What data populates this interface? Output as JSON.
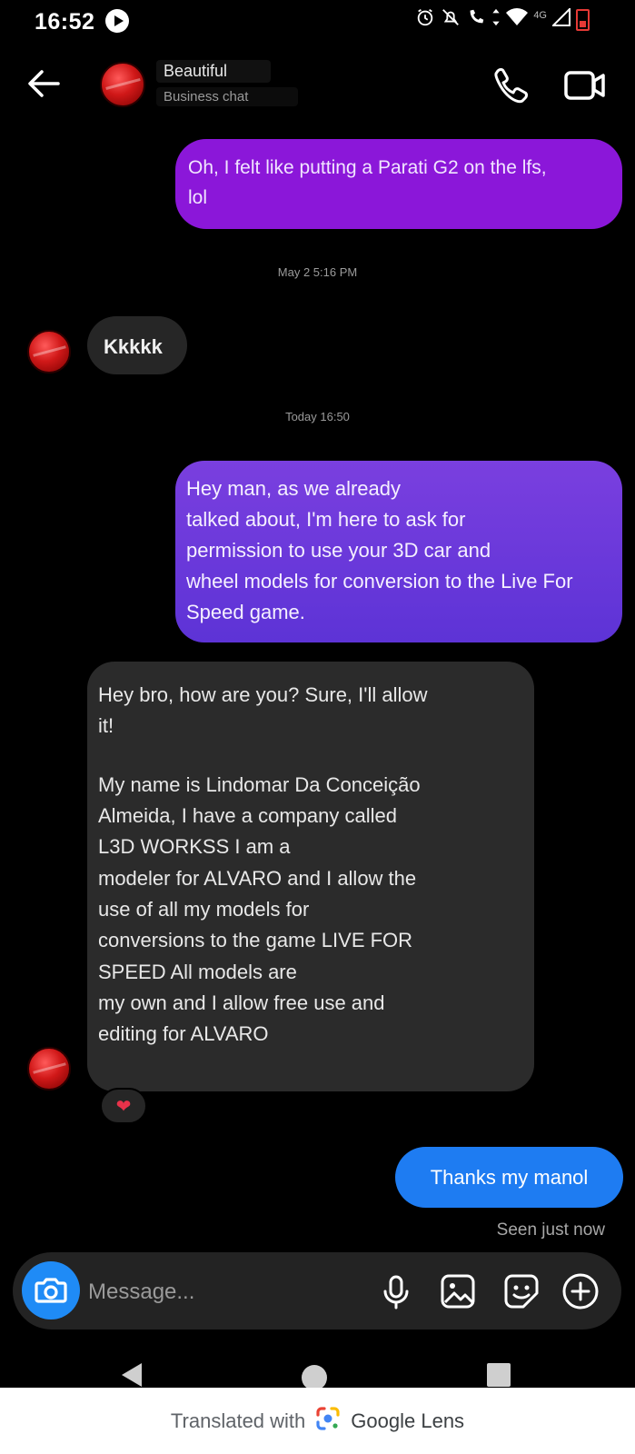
{
  "status_bar": {
    "time": "16:52",
    "network_label": "4G",
    "icons": [
      "play-icon",
      "alarm-icon",
      "mute-icon",
      "wifi-calling-icon",
      "data-arrows-icon",
      "wifi-icon",
      "signal-icon",
      "battery-low-icon"
    ]
  },
  "header": {
    "contact_name": "Beautiful",
    "subtitle": "Business chat"
  },
  "messages": {
    "m1": {
      "sender": "me",
      "lines": [
        "Oh, I felt like putting a Parati G2 on the lfs,",
        "lol"
      ]
    },
    "ts1": "May 2 5:16 PM",
    "m2": {
      "sender": "contact",
      "text": "Kkkkk"
    },
    "ts2": "Today 16:50",
    "m3": {
      "sender": "me",
      "lines": [
        "Hey man, as we already",
        "talked about, I'm here to ask for",
        "permission to use your 3D car and",
        "wheel models for conversion to the Live For",
        "Speed game."
      ]
    },
    "m4": {
      "sender": "contact",
      "paragraph1": "Hey bro, how are you? Sure, I'll allow\nit!",
      "paragraph2": "My name is Lindomar Da Conceição\nAlmeida, I have a company called\nL3D WORKSS I am a\nmodeler for ALVARO and I allow the\nuse of all my models for\nconversions to the game LIVE FOR\nSPEED All models are\nmy own and I allow free use and\nediting for ALVARO",
      "reaction": "❤"
    },
    "m5": {
      "sender": "me",
      "text": "Thanks my manol"
    },
    "seen_status": "Seen just now"
  },
  "composer": {
    "placeholder": "Message..."
  },
  "footer": {
    "prefix": "Translated with",
    "brand": "Google Lens"
  },
  "colors": {
    "background": "#000000",
    "outgoing_purple": "#8b17d9",
    "outgoing_violet": "#5d33d6",
    "outgoing_blue": "#1e7cf2",
    "incoming_gray": "#2b2b2b",
    "camera_button": "#1f8bf6"
  }
}
